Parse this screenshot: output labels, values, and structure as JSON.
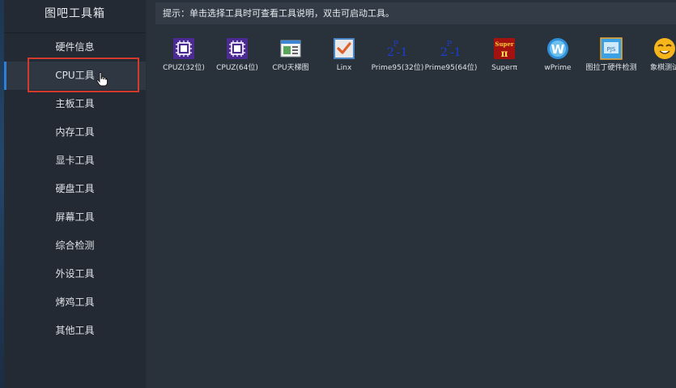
{
  "app": {
    "title": "图吧工具箱"
  },
  "sidebar": {
    "items": [
      {
        "label": "硬件信息"
      },
      {
        "label": "CPU工具"
      },
      {
        "label": "主板工具"
      },
      {
        "label": "内存工具"
      },
      {
        "label": "显卡工具"
      },
      {
        "label": "硬盘工具"
      },
      {
        "label": "屏幕工具"
      },
      {
        "label": "综合检测"
      },
      {
        "label": "外设工具"
      },
      {
        "label": "烤鸡工具"
      },
      {
        "label": "其他工具"
      }
    ],
    "active_index": 1
  },
  "main": {
    "hint": "提示：单击选择工具时可查看工具说明，双击可启动工具。",
    "tools": [
      {
        "label": "CPUZ(32位)",
        "icon": "cpuz-icon"
      },
      {
        "label": "CPUZ(64位)",
        "icon": "cpuz-icon"
      },
      {
        "label": "CPU天梯图",
        "icon": "chart-window-icon"
      },
      {
        "label": "Linx",
        "icon": "checkbox-icon"
      },
      {
        "label": "Prime95(32位)",
        "icon": "prime95-icon",
        "glyph": "2ᴾ−1"
      },
      {
        "label": "Prime95(64位)",
        "icon": "prime95-icon",
        "glyph": "2ᴾ−1"
      },
      {
        "label": "Superπ",
        "icon": "superpi-icon",
        "glyph": "Super π"
      },
      {
        "label": "wPrime",
        "icon": "wprime-icon",
        "glyph": "W"
      },
      {
        "label": "图拉丁硬件检测",
        "icon": "pjs-icon",
        "glyph": "PJS"
      },
      {
        "label": "象棋测试",
        "icon": "smiley-icon"
      }
    ]
  },
  "colors": {
    "accent": "#2f7fd6",
    "highlight": "#d23a2c"
  }
}
